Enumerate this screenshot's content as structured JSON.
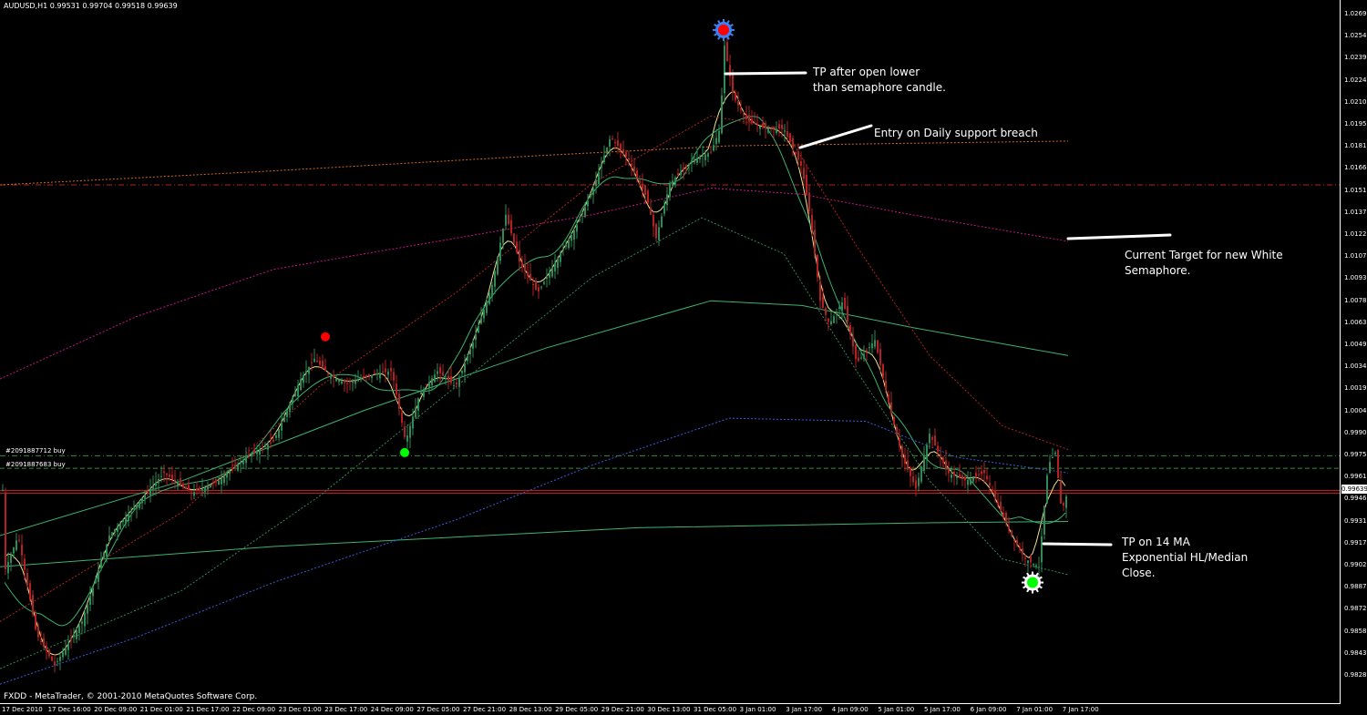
{
  "window": {
    "symbol_header": "AUDUSD,H1  0.99531 0.99704 0.99518 0.99639",
    "copyright": "FXDD - MetaTrader, © 2001-2010 MetaQuotes Software Corp.",
    "current_price": "0.99639"
  },
  "orders": [
    {
      "label": "#2091887712 buy",
      "price": 0.9986
    },
    {
      "label": "#2091887683 buy",
      "price": 0.9978
    }
  ],
  "price_axis": [
    "1.02690",
    "1.02545",
    "1.02395",
    "1.02245",
    "1.02100",
    "1.01955",
    "1.01810",
    "1.01660",
    "1.01515",
    "1.01370",
    "1.01225",
    "1.01075",
    "1.00930",
    "1.00780",
    "1.00635",
    "1.00490",
    "1.00340",
    "1.00190",
    "1.00045",
    "0.99900",
    "0.99755",
    "0.99610",
    "0.99460",
    "0.99315",
    "0.99170",
    "0.99020",
    "0.98870",
    "0.98725",
    "0.98580",
    "0.98430",
    "0.98285"
  ],
  "time_axis": [
    "17 Dec 2010",
    "17 Dec 16:00",
    "20 Dec 09:00",
    "21 Dec 01:00",
    "21 Dec 17:00",
    "22 Dec 09:00",
    "23 Dec 01:00",
    "23 Dec 17:00",
    "24 Dec 09:00",
    "27 Dec 05:00",
    "27 Dec 21:00",
    "28 Dec 13:00",
    "29 Dec 05:00",
    "29 Dec 21:00",
    "30 Dec 13:00",
    "31 Dec 05:00",
    "3 Jan 01:00",
    "3 Jan 17:00",
    "4 Jan 09:00",
    "5 Jan 01:00",
    "5 Jan 17:00",
    "6 Jan 09:00",
    "7 Jan 01:00",
    "7 Jan 17:00"
  ],
  "annotations": {
    "tp_open_lower": [
      "TP after open lower",
      "than semaphore candle."
    ],
    "entry_breach": "Entry on Daily support breach",
    "current_target": [
      "Current Target for new White",
      "Semaphore."
    ],
    "tp_14ma": [
      "TP on 14 MA",
      "Exponential HL/Median",
      "Close."
    ]
  },
  "chart_data": {
    "type": "candlestick",
    "symbol": "AUDUSD",
    "timeframe": "H1",
    "ylim": [
      0.98285,
      1.0269
    ],
    "last_bar": {
      "open": 0.99531,
      "high": 0.99704,
      "low": 0.99518,
      "close": 0.99639
    },
    "horizontal_levels": [
      {
        "price": 1.0159,
        "style": "dash-dot",
        "color": "#b22222"
      },
      {
        "price": 0.9986,
        "style": "dash-dot",
        "color": "#3c8c3c"
      },
      {
        "price": 0.9978,
        "style": "dash",
        "color": "#3c8c3c"
      },
      {
        "price": 0.99639,
        "style": "solid",
        "color": "#cc2222"
      },
      {
        "price": 0.9962,
        "style": "solid",
        "color": "#cc2222"
      }
    ],
    "semaphore_markers": [
      {
        "time": "23 Dec 02:00",
        "price": 1.0062,
        "color": "#ff0000"
      },
      {
        "time": "24 Dec 07:00",
        "price": 0.9988,
        "color": "#00ff00"
      },
      {
        "time": "31 Dec 05:00",
        "price": 1.0258,
        "color": "#ff0000",
        "halo": "#3b82f6"
      },
      {
        "time": "7 Jan 05:00",
        "price": 0.9905,
        "color": "#00ff00",
        "halo": "#ffffff"
      }
    ],
    "colors": {
      "bull": "#2e8b57",
      "bear": "#b22222",
      "ma_fast": "#f0e68c",
      "ma_green": "#3cb371",
      "ma_magenta": "#c71585",
      "ma_blue": "#3b5bdb",
      "ma_orange": "#d2691e"
    }
  }
}
